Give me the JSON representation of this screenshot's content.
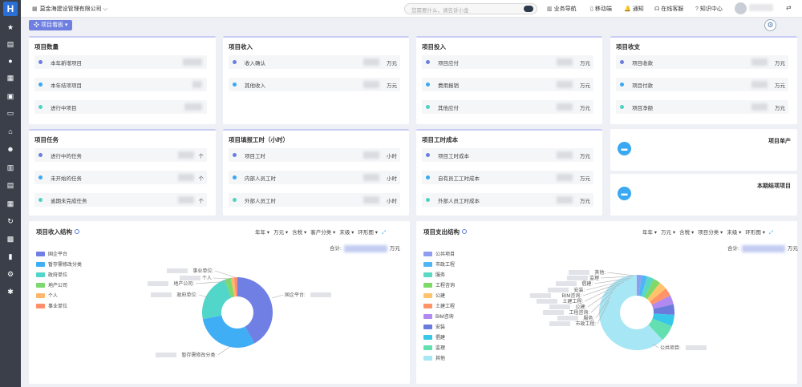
{
  "topbar": {
    "company": "莫金海建设管理有限公司",
    "search_placeholder": "您需要什么，请告诉小金",
    "links": [
      "业务导航",
      "移动端",
      "通知",
      "在线客服",
      "知识中心"
    ]
  },
  "tab_label": "项目看板",
  "cards": [
    {
      "title": "项目数量",
      "rows": [
        {
          "label": "本年新增项目",
          "unit": "",
          "color": "#6c7ee0"
        },
        {
          "label": "本年结项项目",
          "unit": "",
          "color": "#3aa8f2"
        },
        {
          "label": "进行中项目",
          "unit": "",
          "color": "#4fd1c5"
        }
      ]
    },
    {
      "title": "项目收入",
      "rows": [
        {
          "label": "收入确认",
          "unit": "万元",
          "color": "#6c7ee0"
        },
        {
          "label": "其他收入",
          "unit": "万元",
          "color": "#3aa8f2"
        }
      ]
    },
    {
      "title": "项目投入",
      "rows": [
        {
          "label": "项目应付",
          "unit": "万元",
          "color": "#6c7ee0"
        },
        {
          "label": "费用报销",
          "unit": "万元",
          "color": "#3aa8f2"
        },
        {
          "label": "其他应付",
          "unit": "万元",
          "color": "#4fd1c5"
        }
      ]
    },
    {
      "title": "项目收支",
      "rows": [
        {
          "label": "项目收款",
          "unit": "万元",
          "color": "#6c7ee0"
        },
        {
          "label": "项目付款",
          "unit": "万元",
          "color": "#3aa8f2"
        },
        {
          "label": "项目净额",
          "unit": "万元",
          "color": "#4fd1c5"
        }
      ]
    },
    {
      "title": "项目任务",
      "rows": [
        {
          "label": "进行中的任务",
          "unit": "个",
          "color": "#6c7ee0"
        },
        {
          "label": "未开始的任务",
          "unit": "个",
          "color": "#3aa8f2"
        },
        {
          "label": "逾期未完成任务",
          "unit": "个",
          "color": "#4fd1c5"
        }
      ]
    },
    {
      "title": "项目填报工时（小时）",
      "rows": [
        {
          "label": "项目工时",
          "unit": "小时",
          "color": "#6c7ee0"
        },
        {
          "label": "内部人员工时",
          "unit": "小时",
          "color": "#3aa8f2"
        },
        {
          "label": "外部人员工时",
          "unit": "小时",
          "color": "#4fd1c5"
        }
      ]
    },
    {
      "title": "项目工时成本",
      "rows": [
        {
          "label": "项目工时成本",
          "unit": "万元",
          "color": "#6c7ee0"
        },
        {
          "label": "自有员工工时成本",
          "unit": "万元",
          "color": "#3aa8f2"
        },
        {
          "label": "外部人员工时成本",
          "unit": "万元",
          "color": "#4fd1c5"
        }
      ]
    }
  ],
  "minis": [
    {
      "title": "项目单产"
    },
    {
      "title": "本期结项项目"
    }
  ],
  "income_panel": {
    "title": "项目收入结构",
    "filters": [
      "年年 ▾",
      "万元 ▾",
      "含税 ▾",
      "客户分类 ▾",
      "末级 ▾",
      "环形图 ▾"
    ],
    "total_label": "合计:",
    "total_unit": "万元",
    "legend": [
      {
        "name": "国企平台",
        "color": "#6f7fe3"
      },
      {
        "name": "暂存需修改分类",
        "color": "#40aef5"
      },
      {
        "name": "政府单位",
        "color": "#52d6c9"
      },
      {
        "name": "地产公司",
        "color": "#7dd86d"
      },
      {
        "name": "个人",
        "color": "#ffb86b"
      },
      {
        "name": "事业单位",
        "color": "#ff8f6b"
      }
    ],
    "slice_labels": [
      "事业单位:",
      "个人",
      "地产公司:",
      "政府单位:",
      "国企平台:",
      "暂存需修改分类:"
    ]
  },
  "expense_panel": {
    "title": "项目支出结构",
    "filters": [
      "年年 ▾",
      "万元 ▾",
      "含税 ▾",
      "项目分类 ▾",
      "末级 ▾",
      "环形图 ▾"
    ],
    "total_label": "合计:",
    "total_unit": "万元",
    "legend": [
      {
        "name": "公共项目",
        "color": "#8e9df0"
      },
      {
        "name": "市政工程",
        "color": "#50b5f5"
      },
      {
        "name": "服务",
        "color": "#5bd8c4"
      },
      {
        "name": "工程咨询",
        "color": "#7ed968"
      },
      {
        "name": "公建",
        "color": "#ffc36b"
      },
      {
        "name": "土建工程",
        "color": "#ff9468"
      },
      {
        "name": "BIM咨询",
        "color": "#b08af0"
      },
      {
        "name": "安装",
        "color": "#6a7bdc"
      },
      {
        "name": "倡建",
        "color": "#37c7e8"
      },
      {
        "name": "监理",
        "color": "#64e0b0"
      },
      {
        "name": "其他",
        "color": "#a6e6f5"
      }
    ],
    "slice_labels": [
      "其他:",
      "监理",
      "倡建:",
      "安装:",
      "BIM咨询:",
      "土建工程:",
      "公建:",
      "工程咨询:",
      "服务:",
      "市政工程:",
      "公共项目:"
    ]
  }
}
